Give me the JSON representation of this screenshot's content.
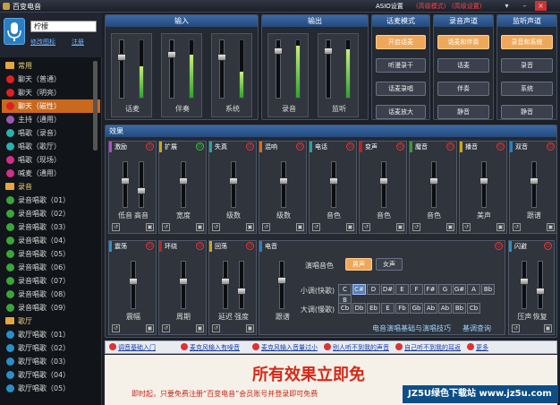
{
  "titlebar": {
    "title": "百变电音",
    "asio": "ASIO设置",
    "link1": "(高级模式)",
    "link2": "(高级设置)"
  },
  "user": {
    "name": "柠檬",
    "change_avatar": "修改图标",
    "login": "注册"
  },
  "sidebar": {
    "items": [
      {
        "type": "cat",
        "label": "常用"
      },
      {
        "type": "ent",
        "label": "聊天（普通）",
        "color": "#e02020"
      },
      {
        "type": "ent",
        "label": "聊天（明亮）",
        "color": "#e02020"
      },
      {
        "type": "ent",
        "label": "聊天（磁性）",
        "color": "#e02020",
        "selected": true
      },
      {
        "type": "ent",
        "label": "主持（通用）",
        "color": "#9b59b6"
      },
      {
        "type": "ent",
        "label": "唱歌（录音）",
        "color": "#2ab0b0"
      },
      {
        "type": "ent",
        "label": "唱歌（歌厅）",
        "color": "#2ab0b0"
      },
      {
        "type": "ent",
        "label": "唱歌（现场）",
        "color": "#d0308a"
      },
      {
        "type": "ent",
        "label": "喊麦（通用）",
        "color": "#d0308a"
      },
      {
        "type": "cat",
        "label": "录音"
      },
      {
        "type": "ent",
        "label": "录音唱歌（01）",
        "color": "#3aa63a"
      },
      {
        "type": "ent",
        "label": "录音唱歌（02）",
        "color": "#3aa63a"
      },
      {
        "type": "ent",
        "label": "录音唱歌（03）",
        "color": "#3aa63a"
      },
      {
        "type": "ent",
        "label": "录音唱歌（04）",
        "color": "#3aa63a"
      },
      {
        "type": "ent",
        "label": "录音唱歌（05）",
        "color": "#3aa63a"
      },
      {
        "type": "ent",
        "label": "录音唱歌（06）",
        "color": "#3aa63a"
      },
      {
        "type": "ent",
        "label": "录音唱歌（07）",
        "color": "#3aa63a"
      },
      {
        "type": "ent",
        "label": "录音唱歌（08）",
        "color": "#3aa63a"
      },
      {
        "type": "ent",
        "label": "录音唱歌（09）",
        "color": "#3aa63a"
      },
      {
        "type": "cat",
        "label": "歌厅"
      },
      {
        "type": "ent",
        "label": "歌厅唱歌（01）",
        "color": "#2a8fc9"
      },
      {
        "type": "ent",
        "label": "歌厅唱歌（02）",
        "color": "#2a8fc9"
      },
      {
        "type": "ent",
        "label": "歌厅唱歌（03）",
        "color": "#2a8fc9"
      },
      {
        "type": "ent",
        "label": "歌厅唱歌（04）",
        "color": "#2a8fc9"
      },
      {
        "type": "ent",
        "label": "歌厅唱歌（05）",
        "color": "#2a8fc9"
      }
    ]
  },
  "input": {
    "title": "输入",
    "channels": [
      {
        "label": "话麦",
        "level": 0.55,
        "fader": 0.7
      },
      {
        "label": "伴奏",
        "level": 0.75,
        "fader": 0.75
      },
      {
        "label": "系统",
        "level": 0.45,
        "fader": 0.7
      }
    ]
  },
  "output": {
    "title": "输出",
    "channels": [
      {
        "label": "录音",
        "level": 0.9,
        "fader": 0.8
      },
      {
        "label": "监听",
        "level": 0.85,
        "fader": 0.8
      }
    ]
  },
  "mode": {
    "title": "话麦模式",
    "buttons": [
      "开启话麦",
      "听漫录干",
      "话麦录唱",
      "话麦放大"
    ],
    "active": 0
  },
  "rec": {
    "title": "录音声道",
    "buttons": [
      "话麦和伴奏",
      "话麦",
      "伴奏",
      "静音"
    ],
    "active": 0
  },
  "mon": {
    "title": "监听声道",
    "buttons": [
      "录音和系统",
      "录音",
      "系统",
      "静音"
    ],
    "active": 0
  },
  "effects": {
    "title": "效果",
    "row1": [
      {
        "name": "激励",
        "color": "#b04ad0",
        "sliders": [
          "低音",
          "高音"
        ],
        "on": false
      },
      {
        "name": "扩展",
        "color": "#c9a818",
        "sliders": [
          "宽度"
        ],
        "on": true
      },
      {
        "name": "失真",
        "color": "#2aa0a0",
        "sliders": [
          "级数"
        ],
        "on": false
      },
      {
        "name": "混响",
        "color": "#e06a1a",
        "sliders": [
          "级数"
        ],
        "on": false
      },
      {
        "name": "电话",
        "color": "#2aa0a0",
        "sliders": [
          "音色"
        ],
        "on": false
      },
      {
        "name": "变声",
        "color": "#c02020",
        "sliders": [
          "音色"
        ],
        "on": false
      },
      {
        "name": "魔音",
        "color": "#3a9a3a",
        "sliders": [
          "音色"
        ],
        "on": false
      },
      {
        "name": "播音",
        "color": "#c9a818",
        "sliders": [
          "美声"
        ],
        "on": false
      },
      {
        "name": "双音",
        "color": "#2a7fc1",
        "sliders": [
          "跟谱"
        ],
        "on": false
      }
    ],
    "row2": [
      {
        "name": "震荡",
        "color": "#2a8fc9",
        "sliders": [
          "震幅"
        ],
        "on": false
      },
      {
        "name": "环绕",
        "color": "#c02020",
        "sliders": [
          "周期"
        ],
        "on": false
      },
      {
        "name": "回荡",
        "color": "#c9a818",
        "sliders": [
          "延迟",
          "强度"
        ],
        "on": false
      }
    ],
    "tune": {
      "name": "电音",
      "slider": "跟谱",
      "tone_label": "演唱音色",
      "tone_buttons": [
        "男声",
        "女声"
      ],
      "tone_active": 0,
      "minor_label": "小调(快歌)",
      "minor_keys": [
        "C",
        "C#",
        "D",
        "D#",
        "E",
        "F",
        "F#",
        "G",
        "G#",
        "A",
        "Bb",
        "B"
      ],
      "minor_active": 1,
      "major_label": "大调(慢歌)",
      "major_keys": [
        "Cb",
        "Db",
        "Eb",
        "E",
        "Fb",
        "Gb",
        "Ab",
        "Ab",
        "Bb",
        "Cb"
      ],
      "link1": "电音演唱基础与演唱技巧",
      "link2": "基调查询"
    },
    "gate": {
      "name": "闪避",
      "color": "#2a8fc9",
      "sliders": [
        "压声",
        "恢复"
      ]
    }
  },
  "toolbar2": [
    "调音基础入门",
    "麦克风输入有噪音",
    "麦克风输入音量过小",
    "别人听不到我的声音",
    "自己听不到我的耳返",
    "更多"
  ],
  "banner": {
    "headline": "所有效果立即免",
    "sub": "即时起，只要免费注册“百变电音”会员账号并登录即可免费"
  },
  "watermark": "JZ5U绿色下载站 www.jz5u.com"
}
